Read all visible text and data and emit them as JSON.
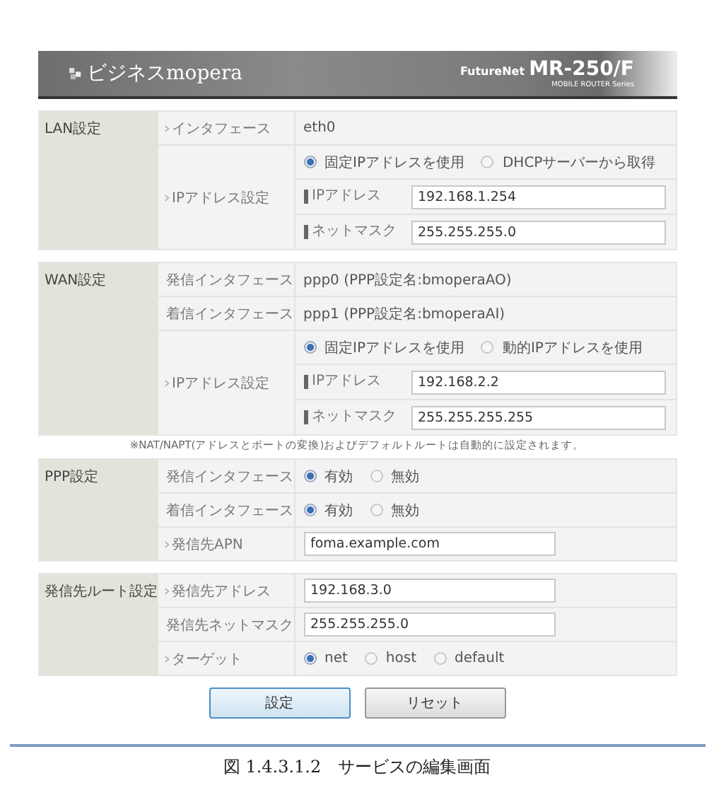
{
  "banner": {
    "brand": "ビジネスmopera",
    "product_prefix": "FutureNet",
    "product": "MR-250/F",
    "series": "MOBILE ROUTER Series"
  },
  "sections": [
    {
      "title": "LAN設定",
      "rows": [
        {
          "kind": "text",
          "label": "インタフェース",
          "value": "eth0"
        },
        {
          "kind": "group",
          "label": "IPアドレス設定",
          "items": [
            {
              "kind": "radio",
              "options": [
                {
                  "label": "固定IPアドレスを使用",
                  "selected": true
                },
                {
                  "label": "DHCPサーバーから取得",
                  "selected": false
                }
              ]
            },
            {
              "kind": "field",
              "label": "IPアドレス",
              "value": "192.168.1.254"
            },
            {
              "kind": "field",
              "label": "ネットマスク",
              "value": "255.255.255.0"
            }
          ]
        }
      ]
    },
    {
      "title": "WAN設定",
      "rows": [
        {
          "kind": "text",
          "label": "発信インタフェース",
          "value": "ppp0 (PPP設定名:bmoperaAO)"
        },
        {
          "kind": "text",
          "label": "着信インタフェース",
          "value": "ppp1 (PPP設定名:bmoperaAI)"
        },
        {
          "kind": "group",
          "label": "IPアドレス設定",
          "items": [
            {
              "kind": "radio",
              "options": [
                {
                  "label": "固定IPアドレスを使用",
                  "selected": true
                },
                {
                  "label": "動的IPアドレスを使用",
                  "selected": false
                }
              ]
            },
            {
              "kind": "field",
              "label": "IPアドレス",
              "value": "192.168.2.2"
            },
            {
              "kind": "field",
              "label": "ネットマスク",
              "value": "255.255.255.255"
            }
          ]
        }
      ],
      "note": "※NAT/NAPT(アドレスとポートの変換)およびデフォルトルートは自動的に設定されます。"
    },
    {
      "title": "PPP設定",
      "rows": [
        {
          "kind": "radio",
          "label": "発信インタフェース",
          "options": [
            {
              "label": "有効",
              "selected": true
            },
            {
              "label": "無効",
              "selected": false
            }
          ]
        },
        {
          "kind": "radio",
          "label": "着信インタフェース",
          "options": [
            {
              "label": "有効",
              "selected": true
            },
            {
              "label": "無効",
              "selected": false
            }
          ]
        },
        {
          "kind": "field",
          "label": "発信先APN",
          "value": "foma.example.com"
        }
      ]
    },
    {
      "title": "発信先ルート設定",
      "rows": [
        {
          "kind": "field",
          "label": "発信先アドレス",
          "value": "192.168.3.0"
        },
        {
          "kind": "field",
          "label": "発信先ネットマスク",
          "value": "255.255.255.0"
        },
        {
          "kind": "radio",
          "label": "ターゲット",
          "options": [
            {
              "label": "net",
              "selected": true
            },
            {
              "label": "host",
              "selected": false
            },
            {
              "label": "default",
              "selected": false
            }
          ]
        }
      ]
    }
  ],
  "buttons": [
    {
      "label": "設定",
      "kind": "primary"
    },
    {
      "label": "リセット",
      "kind": "normal"
    }
  ],
  "caption": "図 1.4.3.1.2　サービスの編集画面"
}
